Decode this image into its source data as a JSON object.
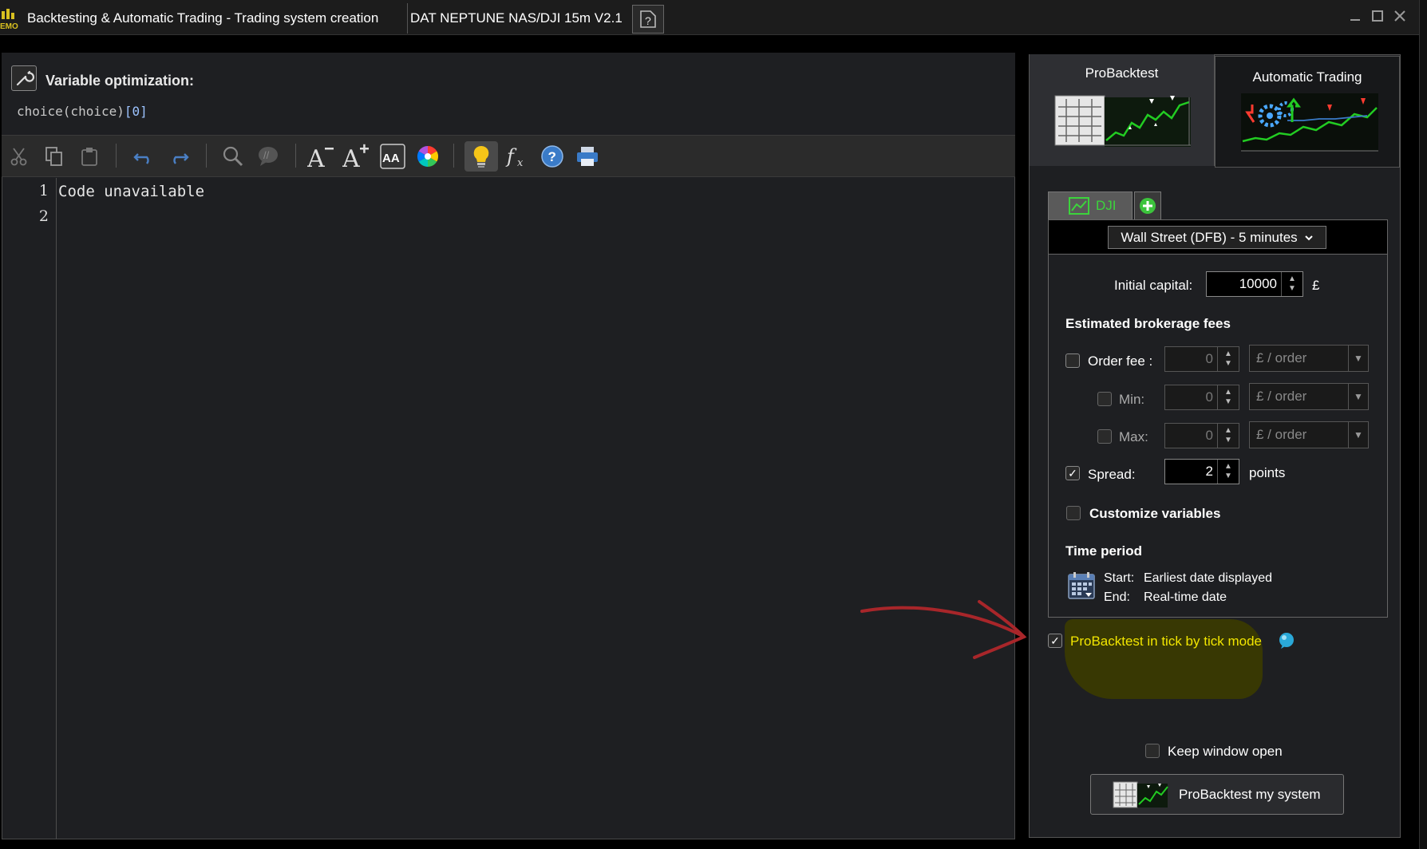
{
  "window": {
    "title": "Backtesting & Automatic Trading - Trading system creation",
    "system_tab": "DAT NEPTUNE NAS/DJI 15m V2.1",
    "demo_badge": "EMO"
  },
  "optimization": {
    "title": "Variable optimization:",
    "expr_text": "choice(choice)",
    "expr_index": "[0]"
  },
  "toolbar": {
    "icons": [
      "cut-icon",
      "copy-icon",
      "paste-icon",
      "undo-icon",
      "redo-icon",
      "search-icon",
      "comment-icon",
      "decrease-font-icon",
      "increase-font-icon",
      "font-case-icon",
      "color-wheel-icon",
      "lightbulb-icon",
      "function-icon",
      "help-icon",
      "print-icon"
    ]
  },
  "editor": {
    "line_numbers": [
      "1",
      "2"
    ],
    "lines": [
      "Code unavailable",
      ""
    ]
  },
  "tabs": {
    "probacktest": "ProBacktest",
    "automatic_trading": "Automatic Trading"
  },
  "instrument": {
    "tab_label": "DJI",
    "selected": "Wall Street (DFB) - 5 minutes"
  },
  "settings": {
    "initial_capital_label": "Initial capital:",
    "initial_capital_value": "10000",
    "currency": "£",
    "fees_heading": "Estimated brokerage fees",
    "order_fee_label": "Order fee :",
    "order_fee_value": "0",
    "order_fee_unit": "£ / order",
    "min_label": "Min:",
    "min_value": "0",
    "min_unit": "£ / order",
    "max_label": "Max:",
    "max_value": "0",
    "max_unit": "£ / order",
    "spread_label": "Spread:",
    "spread_value": "2",
    "spread_unit": "points",
    "customize_label": "Customize variables",
    "time_period_heading": "Time period",
    "start_label": "Start:",
    "start_value": "Earliest date displayed",
    "end_label": "End:",
    "end_value": "Real-time date"
  },
  "tick_mode": {
    "label": "ProBacktest in tick by tick mode",
    "checked": true
  },
  "keep_open": {
    "label": "Keep window open",
    "checked": false
  },
  "run_button": {
    "label": "ProBacktest my system"
  },
  "colors": {
    "highlight": "#f2e600",
    "annotation_arrow": "#a8262a",
    "chart_green": "#22cc22"
  }
}
